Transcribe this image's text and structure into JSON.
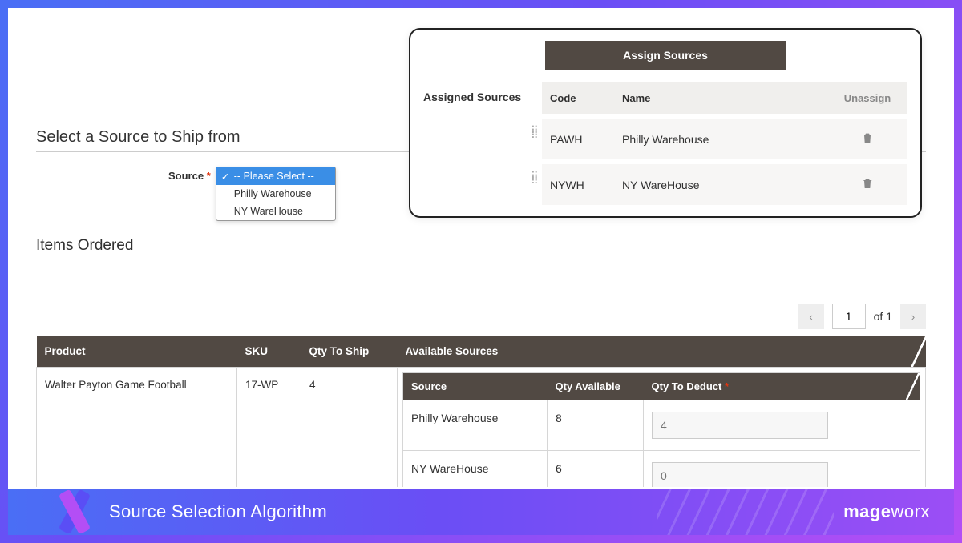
{
  "left": {
    "select_title": "Select a Source to Ship from",
    "source_label": "Source",
    "dropdown": {
      "placeholder": "-- Please Select --",
      "options": [
        "Philly Warehouse",
        "NY WareHouse"
      ]
    },
    "items_title": "Items Ordered"
  },
  "panel": {
    "header": "Assign Sources",
    "label": "Assigned Sources",
    "cols": {
      "code": "Code",
      "name": "Name",
      "unassign": "Unassign"
    },
    "rows": [
      {
        "code": "PAWH",
        "name": "Philly Warehouse"
      },
      {
        "code": "NYWH",
        "name": "NY WareHouse"
      }
    ]
  },
  "pager": {
    "page": "1",
    "of": "of 1"
  },
  "table": {
    "cols": {
      "product": "Product",
      "sku": "SKU",
      "qty": "Qty To Ship",
      "avail": "Available Sources"
    },
    "row": {
      "product": "Walter Payton Game Football",
      "sku": "17-WP",
      "qty": "4"
    },
    "sub": {
      "cols": {
        "source": "Source",
        "avail": "Qty Available",
        "deduct": "Qty To Deduct"
      },
      "rows": [
        {
          "source": "Philly Warehouse",
          "avail": "8",
          "deduct": "4"
        },
        {
          "source": "NY WareHouse",
          "avail": "6",
          "deduct": "0"
        }
      ]
    }
  },
  "banner": {
    "title": "Source Selection Algorithm",
    "brand_a": "mage",
    "brand_b": "worx"
  }
}
